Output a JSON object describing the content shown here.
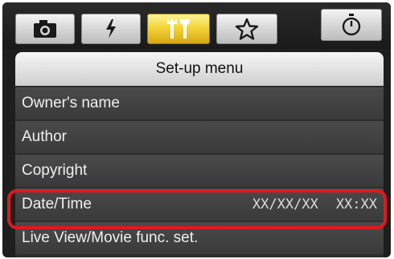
{
  "tabs": [
    {
      "name": "camera",
      "icon": "camera-icon",
      "active": false
    },
    {
      "name": "flash",
      "icon": "flash-icon",
      "active": false
    },
    {
      "name": "setup",
      "icon": "wrench-icon",
      "active": true
    },
    {
      "name": "my-menu",
      "icon": "star-icon",
      "active": false
    },
    {
      "name": "timer",
      "icon": "stopwatch-icon",
      "active": false
    }
  ],
  "menu": {
    "title": "Set-up menu",
    "items": [
      {
        "label": "Owner's name"
      },
      {
        "label": "Author"
      },
      {
        "label": "Copyright"
      },
      {
        "label": "Date/Time",
        "value_date": "XX/XX/XX",
        "value_time": "XX:XX"
      },
      {
        "label": "Live View/Movie func. set."
      }
    ]
  },
  "colors": {
    "accent_tab": "#f2d53a",
    "highlight": "#e0191f"
  }
}
